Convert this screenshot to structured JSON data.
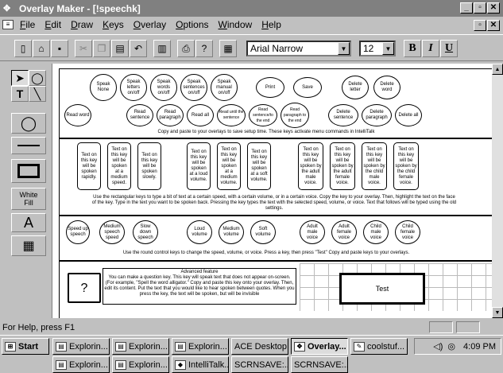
{
  "title": "Overlay Maker - [!speechk]",
  "menu": [
    "File",
    "Edit",
    "Draw",
    "Keys",
    "Overlay",
    "Options",
    "Window",
    "Help"
  ],
  "toolbar": {
    "font": "Arial Narrow",
    "size": "12",
    "bold": "B",
    "italic": "I",
    "underline": "U"
  },
  "palette": {
    "fill_label": "White Fill",
    "text_tool": "A"
  },
  "row1_keys": [
    "Speak None",
    "Speak letters on/off",
    "Speak words on/off",
    "Speak sentences on/off",
    "Speak manual on/off",
    "Print",
    "Save",
    "Delete letter",
    "Delete word"
  ],
  "row1b_keys": [
    "Read word",
    "Read sentence",
    "Read paragraph",
    "Read all",
    "Read until the sentence",
    "Read sentence/to the end",
    "Read paragraph to the end",
    "Delete sentence",
    "Delete paragraph",
    "Delete all"
  ],
  "row1_note": "Copy and paste to your overlays to save setup time. These keys activate menu commands in IntelliTalk",
  "rect_keys_left": [
    "Text on this key will be spoken rapidly.",
    "Text on this key will be spoken at a medium speed.",
    "Text on this key will be spoken slowly."
  ],
  "rect_keys_mid": [
    "Text on this key will be spoken at a loud volume.",
    "Text on this key will be spoken at a medium volume.",
    "Text on this key will be spoken at a soft volume."
  ],
  "rect_keys_right": [
    "Text on this key will be spoken by the adult male voice.",
    "Text on this key will be spoken by the adult female voice.",
    "Text on this key will be spoken by the child male voice.",
    "Text on this key will be spoken by the child female voice."
  ],
  "rect_note": "Use the rectangular keys to type a bit of text at a certain speed, with a certain volume, or in a certain voice. Copy the key to your overlay. Then, highlight the text on the face of the key. Type in the text you want to be spoken back. Pressing the key types the text with the selected speed, volume, or voice. Text that follows will be typed using the old settings.",
  "round_keys": [
    "Speed up speech",
    "Medium speech speed",
    "Slow down speech",
    "Loud volume",
    "Medium volume",
    "Soft volume",
    "Adult male voice",
    "Adult female voice",
    "Child male voice",
    "Child female voice"
  ],
  "round_note": "Use the round control keys to change the speed, volume, or voice. Press a key, then press \"Test\" Copy and paste keys to your overlays.",
  "question_key": "?",
  "advanced_note": "Advanced feature\nYou can make a question key. This key will speak text that does not appear on-screen. (For example, \"Spell the word alligator.\" Copy and paste this key onto your overlay. Then, edit its content. Put the text that you would like to hear spoken between quotes. When you press the key, the text will be spoken, but will be invisible",
  "test_key": "Test",
  "status": "For Help, press F1",
  "taskbar": {
    "start": "Start",
    "row1": [
      "Explorin...",
      "Explorin...",
      "Explorin...",
      "ACE Desktop",
      "Overlay...",
      "coolstuf..."
    ],
    "row2": [
      "Explorin...",
      "Explorin...",
      "IntelliTalk...",
      "SCRNSAVE:...",
      "SCRNSAVE:..."
    ],
    "clock": "4:09 PM"
  }
}
